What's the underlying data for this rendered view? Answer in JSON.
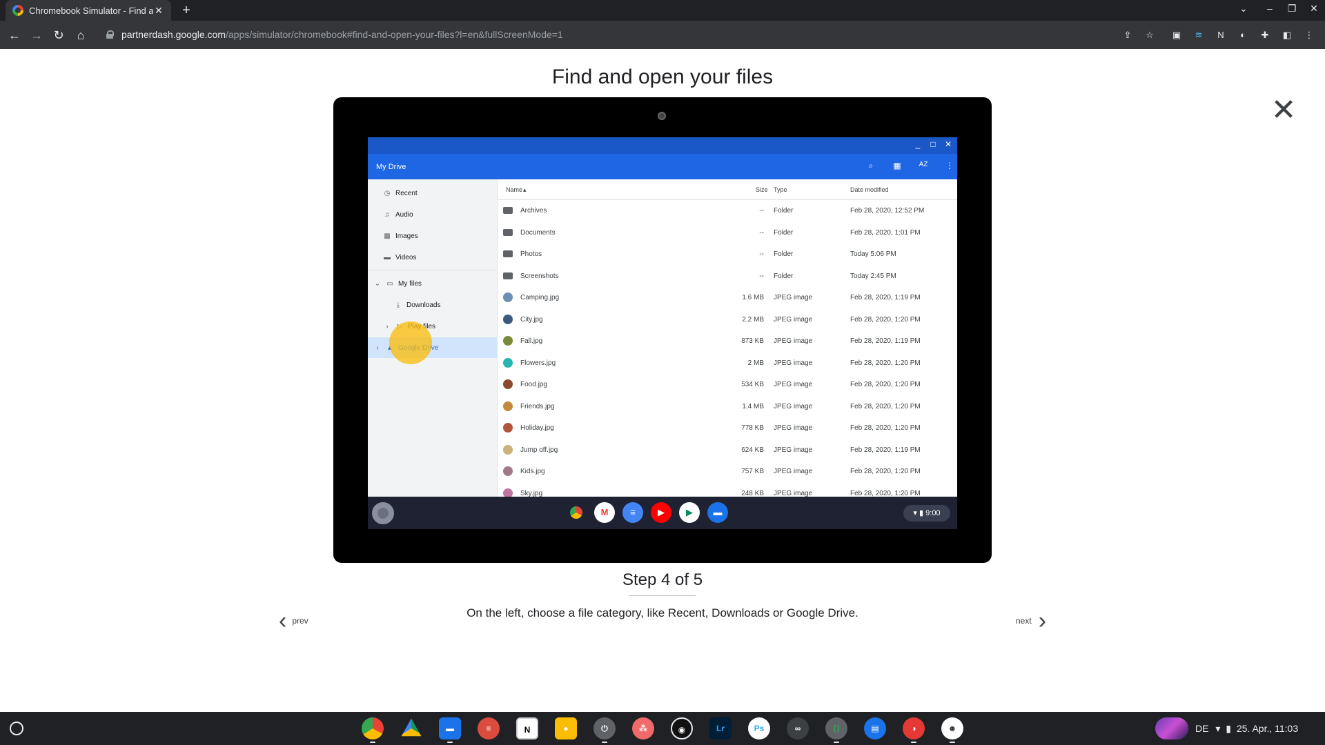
{
  "browser": {
    "tab_title": "Chromebook Simulator - Find ar",
    "url_host": "partnerdash.google.com",
    "url_path": "/apps/simulator/chromebook#find-and-open-your-files?l=en&fullScreenMode=1"
  },
  "page": {
    "title": "Find and open your files",
    "step": "Step 4 of 5",
    "description": "On the left, choose a file category, like Recent, Downloads or Google Drive.",
    "prev_label": "prev",
    "next_label": "next"
  },
  "files_app": {
    "header_title": "My Drive",
    "sort_label": "AZ",
    "sidebar": [
      {
        "label": "Recent",
        "icon": "clock-icon"
      },
      {
        "label": "Audio",
        "icon": "audio-icon"
      },
      {
        "label": "Images",
        "icon": "image-icon"
      },
      {
        "label": "Videos",
        "icon": "video-icon"
      },
      {
        "label": "My files",
        "icon": "laptop-icon"
      },
      {
        "label": "Downloads",
        "icon": "download-icon"
      },
      {
        "label": "Play files",
        "icon": "play-icon"
      },
      {
        "label": "Google Drive",
        "icon": "drive-icon",
        "selected": true
      }
    ],
    "columns": {
      "name": "Name",
      "size": "Size",
      "type": "Type",
      "date": "Date modified"
    },
    "rows": [
      {
        "name": "Archives",
        "size": "--",
        "type": "Folder",
        "date": "Feb 28, 2020, 12:52 PM",
        "kind": "folder"
      },
      {
        "name": "Documents",
        "size": "--",
        "type": "Folder",
        "date": "Feb 28, 2020, 1:01 PM",
        "kind": "folder"
      },
      {
        "name": "Photos",
        "size": "--",
        "type": "Folder",
        "date": "Today 5:06 PM",
        "kind": "folder"
      },
      {
        "name": "Screenshots",
        "size": "--",
        "type": "Folder",
        "date": "Today 2:45 PM",
        "kind": "folder"
      },
      {
        "name": "Camping.jpg",
        "size": "1.6 MB",
        "type": "JPEG image",
        "date": "Feb 28, 2020, 1:19 PM",
        "kind": "image",
        "color": "#6c8fb3"
      },
      {
        "name": "City.jpg",
        "size": "2.2 MB",
        "type": "JPEG image",
        "date": "Feb 28, 2020, 1:20 PM",
        "kind": "image",
        "color": "#3d5a80"
      },
      {
        "name": "Fall.jpg",
        "size": "873 KB",
        "type": "JPEG image",
        "date": "Feb 28, 2020, 1:19 PM",
        "kind": "image",
        "color": "#7a8b3a"
      },
      {
        "name": "Flowers.jpg",
        "size": "2 MB",
        "type": "JPEG image",
        "date": "Feb 28, 2020, 1:20 PM",
        "kind": "image",
        "color": "#26b5b0"
      },
      {
        "name": "Food.jpg",
        "size": "534 KB",
        "type": "JPEG image",
        "date": "Feb 28, 2020, 1:20 PM",
        "kind": "image",
        "color": "#8b4a2b"
      },
      {
        "name": "Friends.jpg",
        "size": "1.4 MB",
        "type": "JPEG image",
        "date": "Feb 28, 2020, 1:20 PM",
        "kind": "image",
        "color": "#c48a3c"
      },
      {
        "name": "Holiday.jpg",
        "size": "778 KB",
        "type": "JPEG image",
        "date": "Feb 28, 2020, 1:20 PM",
        "kind": "image",
        "color": "#b0553c"
      },
      {
        "name": "Jump off.jpg",
        "size": "624 KB",
        "type": "JPEG image",
        "date": "Feb 28, 2020, 1:19 PM",
        "kind": "image",
        "color": "#c9b37a"
      },
      {
        "name": "Kids.jpg",
        "size": "757 KB",
        "type": "JPEG image",
        "date": "Feb 28, 2020, 1:20 PM",
        "kind": "image",
        "color": "#a07a8a"
      },
      {
        "name": "Sky.jpg",
        "size": "248 KB",
        "type": "JPEG image",
        "date": "Feb 28, 2020, 1:20 PM",
        "kind": "image",
        "color": "#c0769e"
      }
    ],
    "shelf_time": "9:00"
  },
  "os_shelf": {
    "apps": [
      "chrome-icon",
      "drive-icon",
      "files-icon",
      "todoist-icon",
      "notion-icon",
      "keep-icon",
      "power-icon",
      "asana-icon",
      "screen-recorder-icon",
      "lightroom-icon",
      "photoshop-icon",
      "creative-cloud-icon",
      "code-icon",
      "messages-icon",
      "dc-icon",
      "penguin-icon"
    ],
    "app_labels": {
      "notion": "N",
      "lightroom": "Lr",
      "photoshop": "Ps"
    },
    "language": "DE",
    "datetime": "25. Apr., 11:03"
  }
}
